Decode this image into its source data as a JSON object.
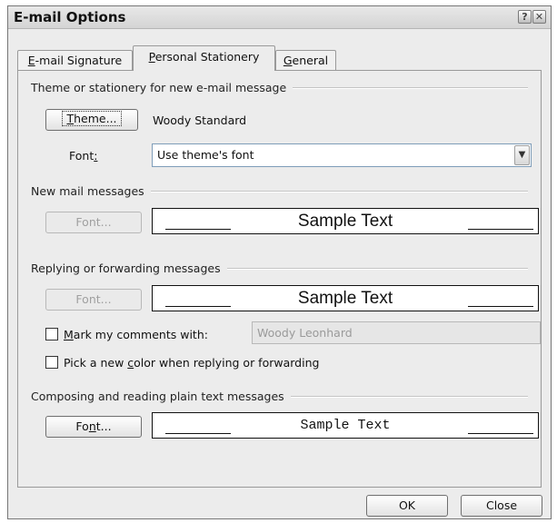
{
  "window": {
    "title": "E-mail Options",
    "help_glyph": "?",
    "close_glyph": "✕"
  },
  "tabs": [
    {
      "label_pre": "",
      "label_key": "E",
      "label_post": "-mail Signature"
    },
    {
      "label_pre": "",
      "label_key": "P",
      "label_post": "ersonal Stationery"
    },
    {
      "label_pre": "",
      "label_key": "G",
      "label_post": "eneral"
    }
  ],
  "stationery": {
    "group_label": "Theme or stationery for new e-mail message",
    "theme_button_key": "T",
    "theme_button_rest": "heme...",
    "theme_name": "Woody Standard",
    "font_label_pre": "Font",
    "font_label_key": ":",
    "font_value": "Use theme's font"
  },
  "new_mail": {
    "group_label": "New mail messages",
    "font_button": "Font...",
    "sample_text": "Sample Text"
  },
  "reply": {
    "group_label": "Replying or forwarding messages",
    "font_button": "Font...",
    "sample_text": "Sample Text",
    "mark_key": "M",
    "mark_rest": "ark my comments with:",
    "mark_value": "Woody Leonhard",
    "pick_pre": "Pick a new ",
    "pick_key": "c",
    "pick_post": "olor when replying or forwarding"
  },
  "plain": {
    "group_label": "Composing and reading plain text messages",
    "font_button_pre": "Fo",
    "font_button_key": "n",
    "font_button_post": "t...",
    "sample_text": "Sample Text"
  },
  "footer": {
    "ok_label": "OK",
    "close_label": "Close"
  }
}
